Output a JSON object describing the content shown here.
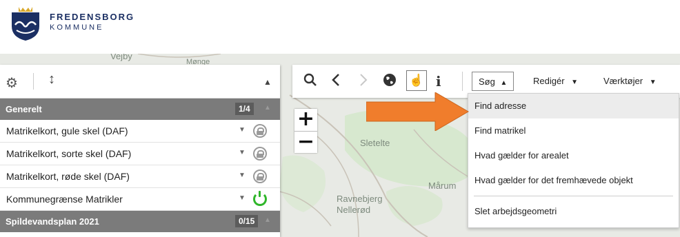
{
  "header": {
    "brand_line1": "FREDENSBORG",
    "brand_line2": "KOMMUNE",
    "logo_icon": "fredensborg-crest-icon"
  },
  "map": {
    "places": [
      "Vejby",
      "Mønge",
      "Sletelte",
      "Mårum",
      "Ravnebjerg",
      "Nellerød"
    ]
  },
  "layer_panel": {
    "settings_icon": "gear-icon",
    "move_icon": "move-vertical-icon",
    "collapse_icon": "caret-up-icon",
    "groups": [
      {
        "label": "Generelt",
        "count": "1/4"
      },
      {
        "label": "Spildevandsplan 2021",
        "count": "0/15"
      }
    ],
    "layers": [
      {
        "label": "Matrikelkort, gule skel (DAF)",
        "status": "locked"
      },
      {
        "label": "Matrikelkort, sorte skel (DAF)",
        "status": "locked"
      },
      {
        "label": "Matrikelkort, røde skel (DAF)",
        "status": "locked"
      },
      {
        "label": "Kommunegrænse Matrikler",
        "status": "on"
      }
    ]
  },
  "zoom": {
    "in": "+",
    "out": "−"
  },
  "toolbar": {
    "search_label": "Søg",
    "edit_label": "Redigér",
    "tools_label": "Værktøjer",
    "icons": [
      "search-icon",
      "back-icon",
      "forward-icon",
      "globe-icon",
      "hand-pan-icon",
      "info-icon"
    ]
  },
  "search_menu": {
    "items": [
      "Find adresse",
      "Find matrikel",
      "Hvad gælder for arealet",
      "Hvad gælder for det fremhævede objekt"
    ],
    "extra": "Slet arbejdsgeometri",
    "highlighted_index": 0
  },
  "colors": {
    "brand": "#1b2f63",
    "arrow": "#f07d2c",
    "group_bg": "#7b7b7b",
    "power_on": "#2fb62a"
  }
}
